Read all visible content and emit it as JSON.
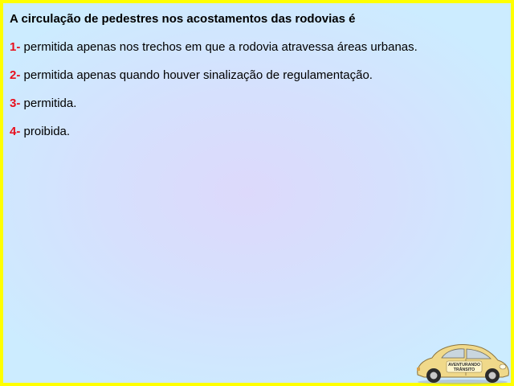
{
  "question": "A circulação de pedestres nos acostamentos das rodovias é",
  "options": [
    {
      "number": "1-",
      "text": "permitida apenas nos trechos em que a rodovia atravessa áreas urbanas."
    },
    {
      "number": "2-",
      "text": "permitida apenas quando houver sinalização de regulamentação."
    },
    {
      "number": "3-",
      "text": "permitida."
    },
    {
      "number": "4-",
      "text": "proibida."
    }
  ],
  "logo": {
    "door_text_line1": "AVENTURANDO",
    "door_text_line2": "TRÂNSITO"
  },
  "colors": {
    "border": "#ffff00",
    "option_number": "#e8101e",
    "text": "#000000",
    "car_body": "#f0d98a"
  }
}
